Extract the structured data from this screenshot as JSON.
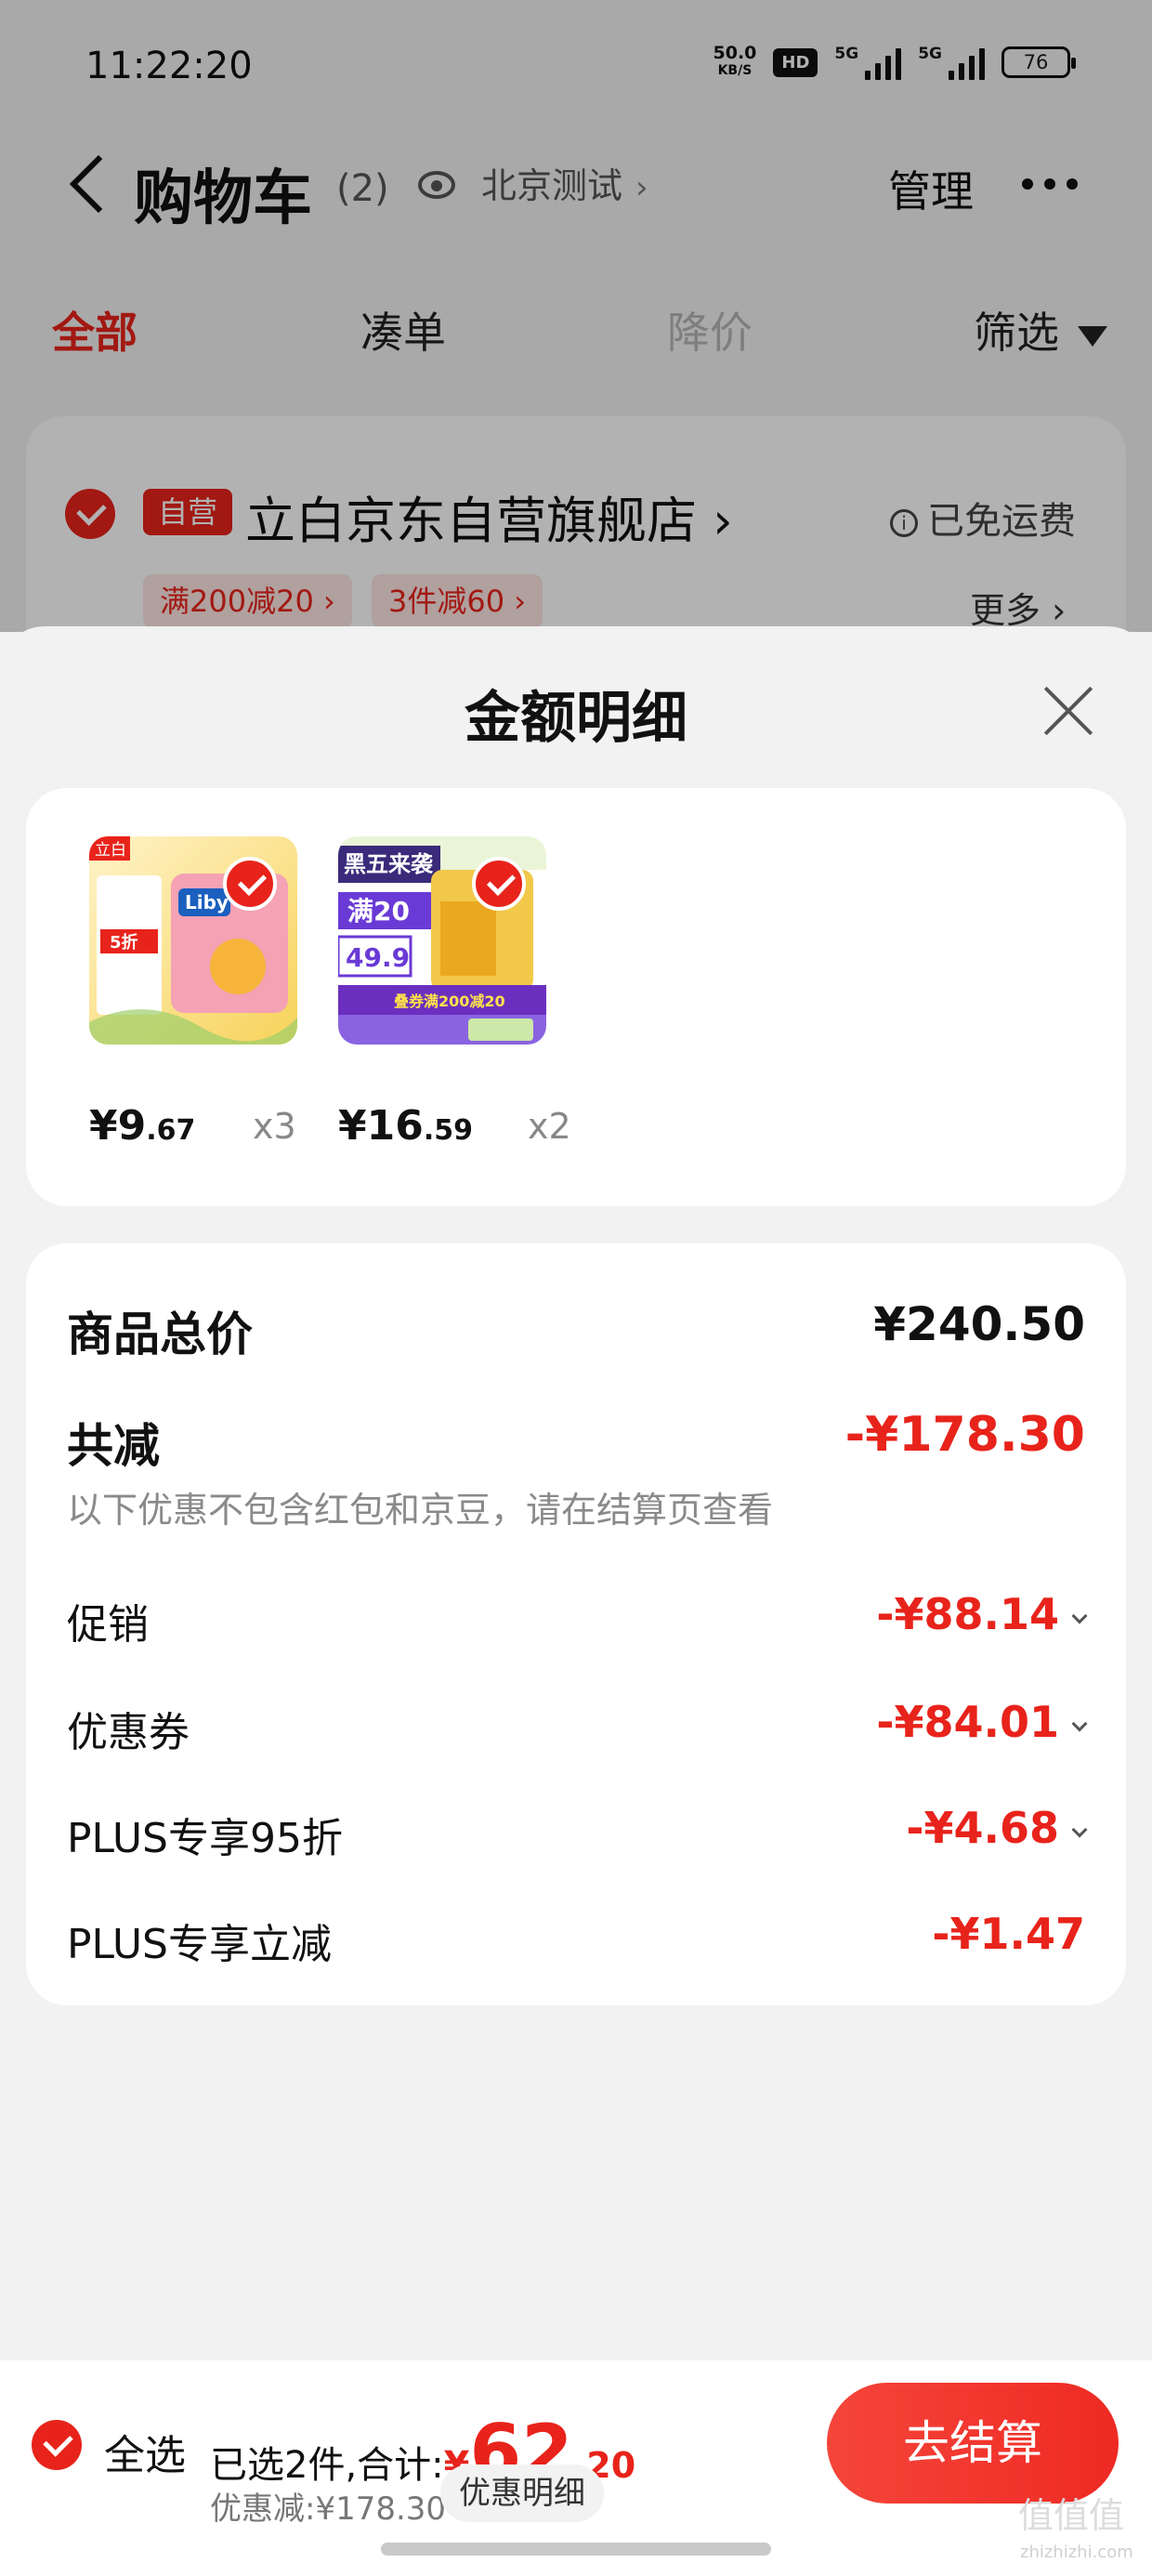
{
  "status_bar": {
    "time": "11:22:20",
    "net_speed": "50.0",
    "net_unit": "KB/S",
    "hd_badge": "HD",
    "signal1": "5G",
    "signal2": "5G",
    "battery": "76"
  },
  "nav": {
    "title": "购物车",
    "count": "(2)",
    "location": "北京测试",
    "manage": "管理"
  },
  "tabs": [
    {
      "label": "全部"
    },
    {
      "label": "凑单"
    },
    {
      "label": "降价"
    },
    {
      "label": "筛选"
    }
  ],
  "shop": {
    "tag": "自营",
    "name": "立白京东自营旗舰店 ›",
    "shipping": "已免运费",
    "promo1": "满200减20 ›",
    "promo2": "3件减60 ›",
    "more": "更多 ›"
  },
  "sheet": {
    "title": "金额明细",
    "items": [
      {
        "price_int": "¥9",
        "price_dec": ".67",
        "qty": "x3",
        "thumb_brand": "立白",
        "thumb_logo": "Liby",
        "thumb_tag": "5折"
      },
      {
        "price_int": "¥16",
        "price_dec": ".59",
        "qty": "x2",
        "thumb_brand": "黑五来袭",
        "thumb_promo": "满20",
        "thumb_price": "49.9",
        "thumb_banner": "叠券满200减20"
      }
    ],
    "goods_total_label": "商品总价",
    "goods_total_value": "¥240.50",
    "total_reduce_label": "共减",
    "total_reduce_value": "-¥178.30",
    "note": "以下优惠不包含红包和京豆，请在结算页查看",
    "rows": [
      {
        "label": "促销",
        "value": "-¥88.14"
      },
      {
        "label": "优惠券",
        "value": "-¥84.01"
      },
      {
        "label": "PLUS专享95折",
        "value": "-¥4.68"
      },
      {
        "label": "PLUS专享立减",
        "value": "-¥1.47"
      }
    ]
  },
  "bottom": {
    "select_all": "全选",
    "selected_text": "已选2件,合计:",
    "total_currency": "¥",
    "total_int": "62",
    "total_dec": ".20",
    "discount_text": "优惠减:¥178.30",
    "detail_chip": "优惠明细",
    "checkout": "去结算",
    "watermark": "值值值",
    "watermark_sub": "zhizhizhi.com"
  },
  "colors": {
    "accent": "#e8231b",
    "background": "#f2f2f2"
  }
}
